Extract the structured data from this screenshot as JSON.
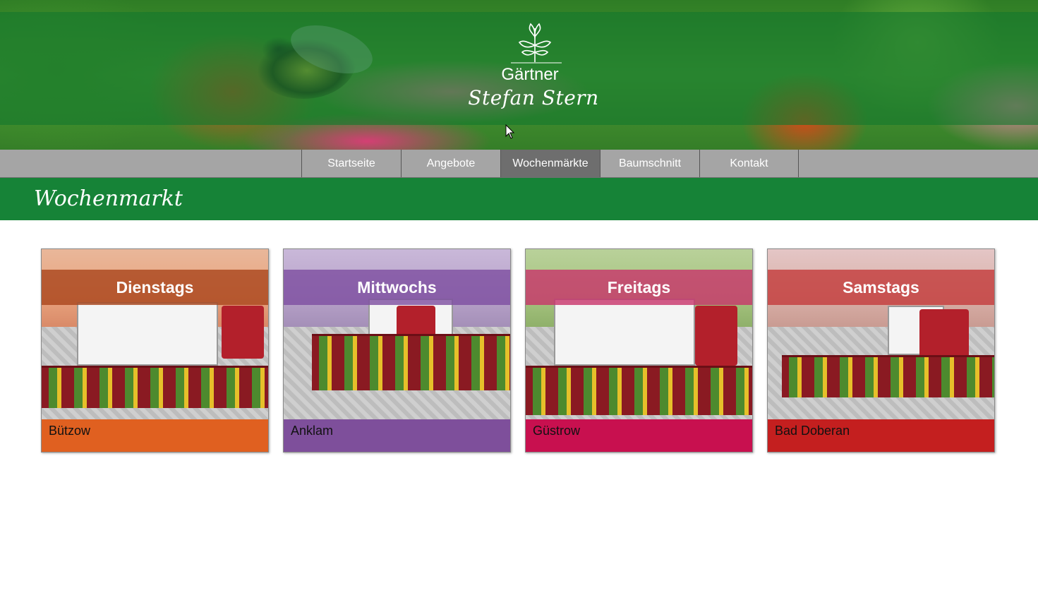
{
  "header": {
    "title": "Gärtner",
    "subtitle": "Stefan Stern",
    "logo_icon": "sprout-icon"
  },
  "nav": {
    "items": [
      {
        "label": "Startseite",
        "active": false
      },
      {
        "label": "Angebote",
        "active": false
      },
      {
        "label": "Wochenmärkte",
        "active": true
      },
      {
        "label": "Baumschnitt",
        "active": false
      },
      {
        "label": "Kontakt",
        "active": false
      }
    ]
  },
  "page": {
    "title": "Wochenmarkt"
  },
  "markets": [
    {
      "day": "Dienstags",
      "place": "Bützow",
      "band_color": "#a9451c",
      "place_color": "#e06020"
    },
    {
      "day": "Mittwochs",
      "place": "Anklam",
      "band_color": "#7d4da0",
      "place_color": "#7e4f9b"
    },
    {
      "day": "Freitags",
      "place": "Güstrow",
      "band_color": "#c8336a",
      "place_color": "#c8104f"
    },
    {
      "day": "Samstags",
      "place": "Bad Doberan",
      "band_color": "#c33b3b",
      "place_color": "#c41f1f"
    }
  ],
  "colors": {
    "nav_bg": "#a5a5a5",
    "nav_active": "#6e6e6e",
    "title_bar": "#168337"
  }
}
